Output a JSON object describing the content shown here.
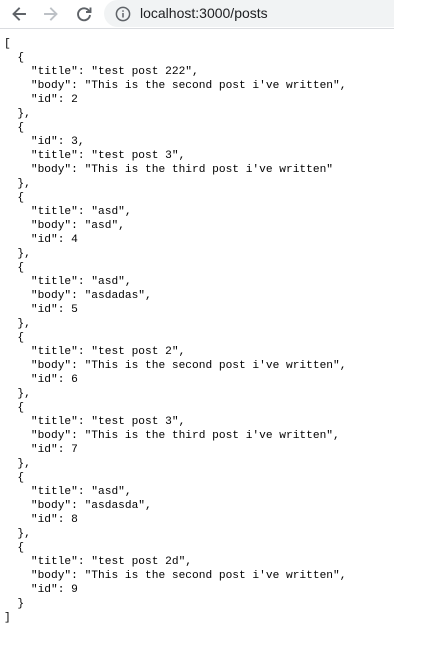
{
  "browser": {
    "url_host": "localhost",
    "url_rest": ":3000/posts"
  },
  "icons": {
    "back": "arrow-left-icon",
    "forward": "arrow-right-icon",
    "reload": "reload-icon",
    "info": "info-circle-icon"
  },
  "colors": {
    "icon_active": "#5f6368",
    "icon_disabled": "#bdc1c6",
    "omnibox_bg": "#f1f3f4"
  },
  "page": {
    "posts": [
      {
        "keys": [
          "title",
          "body",
          "id"
        ],
        "title": "test post 222",
        "body": "This is the second post i've written",
        "id": 2
      },
      {
        "keys": [
          "id",
          "title",
          "body"
        ],
        "id": 3,
        "title": "test post 3",
        "body": "This is the third post i've written"
      },
      {
        "keys": [
          "title",
          "body",
          "id"
        ],
        "title": "asd",
        "body": "asd",
        "id": 4
      },
      {
        "keys": [
          "title",
          "body",
          "id"
        ],
        "title": "asd",
        "body": "asdadas",
        "id": 5
      },
      {
        "keys": [
          "title",
          "body",
          "id"
        ],
        "title": "test post 2",
        "body": "This is the second post i've written",
        "id": 6
      },
      {
        "keys": [
          "title",
          "body",
          "id"
        ],
        "title": "test post 3",
        "body": "This is the third post i've written",
        "id": 7
      },
      {
        "keys": [
          "title",
          "body",
          "id"
        ],
        "title": "asd",
        "body": "asdasda",
        "id": 8
      },
      {
        "keys": [
          "title",
          "body",
          "id"
        ],
        "title": "test post 2d",
        "body": "This is the second post i've written",
        "id": 9
      }
    ]
  }
}
